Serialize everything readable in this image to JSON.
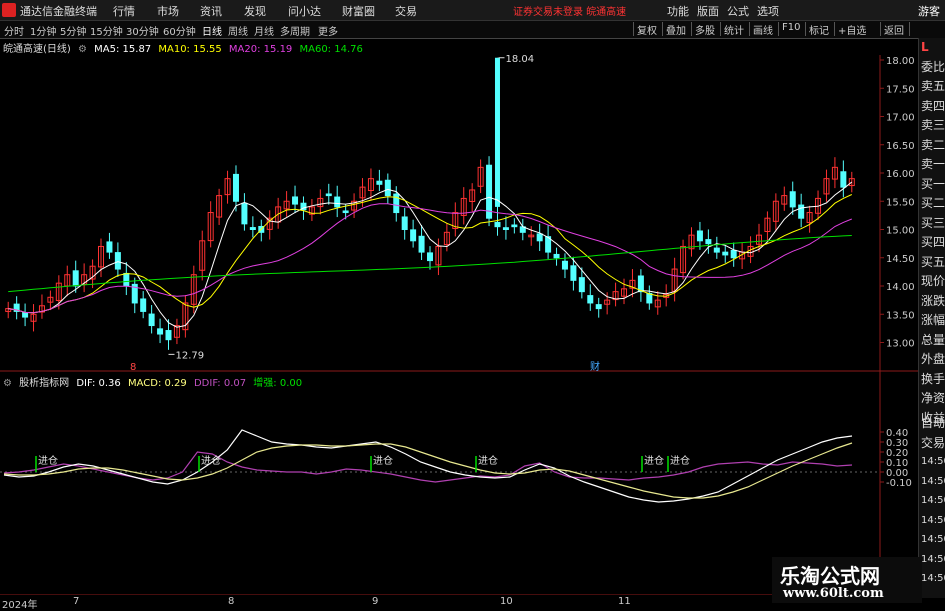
{
  "app": {
    "title": "通达信金融终端",
    "login_notice": "证券交易未登录  皖通高速",
    "guest_label": "游客"
  },
  "menus": [
    "行情",
    "市场",
    "资讯",
    "发现",
    "问小达",
    "财富圈",
    "交易"
  ],
  "menus_right": [
    "功能",
    "版面",
    "公式",
    "选项"
  ],
  "periods": [
    "分时",
    "1分钟",
    "5分钟",
    "15分钟",
    "30分钟",
    "60分钟",
    "日线",
    "周线",
    "月线",
    "多周期",
    "更多"
  ],
  "active_period": "日线",
  "toolbar_right": [
    "复权",
    "叠加",
    "多股",
    "统计",
    "画线",
    "F10",
    "标记",
    "+自选",
    "返回"
  ],
  "main_legend": {
    "stock": "皖通高速(日线)",
    "ma5": "MA5: 15.87",
    "ma10": "MA10: 15.55",
    "ma20": "MA20: 15.19",
    "ma60": "MA60: 14.76",
    "ma5_color": "#ffffff",
    "ma10_color": "#ffff00",
    "ma20_color": "#e040e0",
    "ma60_color": "#00e000"
  },
  "price_axis": [
    "18.00",
    "17.50",
    "17.00",
    "16.50",
    "16.00",
    "15.50",
    "15.00",
    "14.50",
    "14.00",
    "13.50",
    "13.00"
  ],
  "price_high_label": "18.04",
  "price_low_label": "12.79",
  "markers": {
    "low_marker": "8",
    "fin_marker": "财"
  },
  "indicator_legend": {
    "name": "股析指标网",
    "dif": "DIF: 0.36",
    "macd": "MACD: 0.29",
    "ddif": "DDIF: 0.07",
    "strength": "增强: 0.00"
  },
  "indicator_axis": [
    "0.40",
    "0.30",
    "0.20",
    "0.10",
    "0.00",
    "-0.10"
  ],
  "buy_signal_label": "进仓",
  "date_axis": [
    "2024年",
    "7",
    "8",
    "9",
    "10",
    "11"
  ],
  "side_tabs": [
    "L",
    "委比",
    "卖五",
    "卖四",
    "卖三",
    "卖二",
    "卖一",
    "买一",
    "买二",
    "买三",
    "买四",
    "买五",
    "现价",
    "涨跌",
    "涨幅",
    "总量",
    "外盘",
    "换手",
    "净资",
    "收益",
    "自动",
    "交易",
    "14:50",
    "14:50",
    "14:50",
    "14:50",
    "14:50",
    "14:50",
    "14:50"
  ],
  "watermark": {
    "title": "乐淘公式网",
    "url": "www.60lt.com"
  }
}
